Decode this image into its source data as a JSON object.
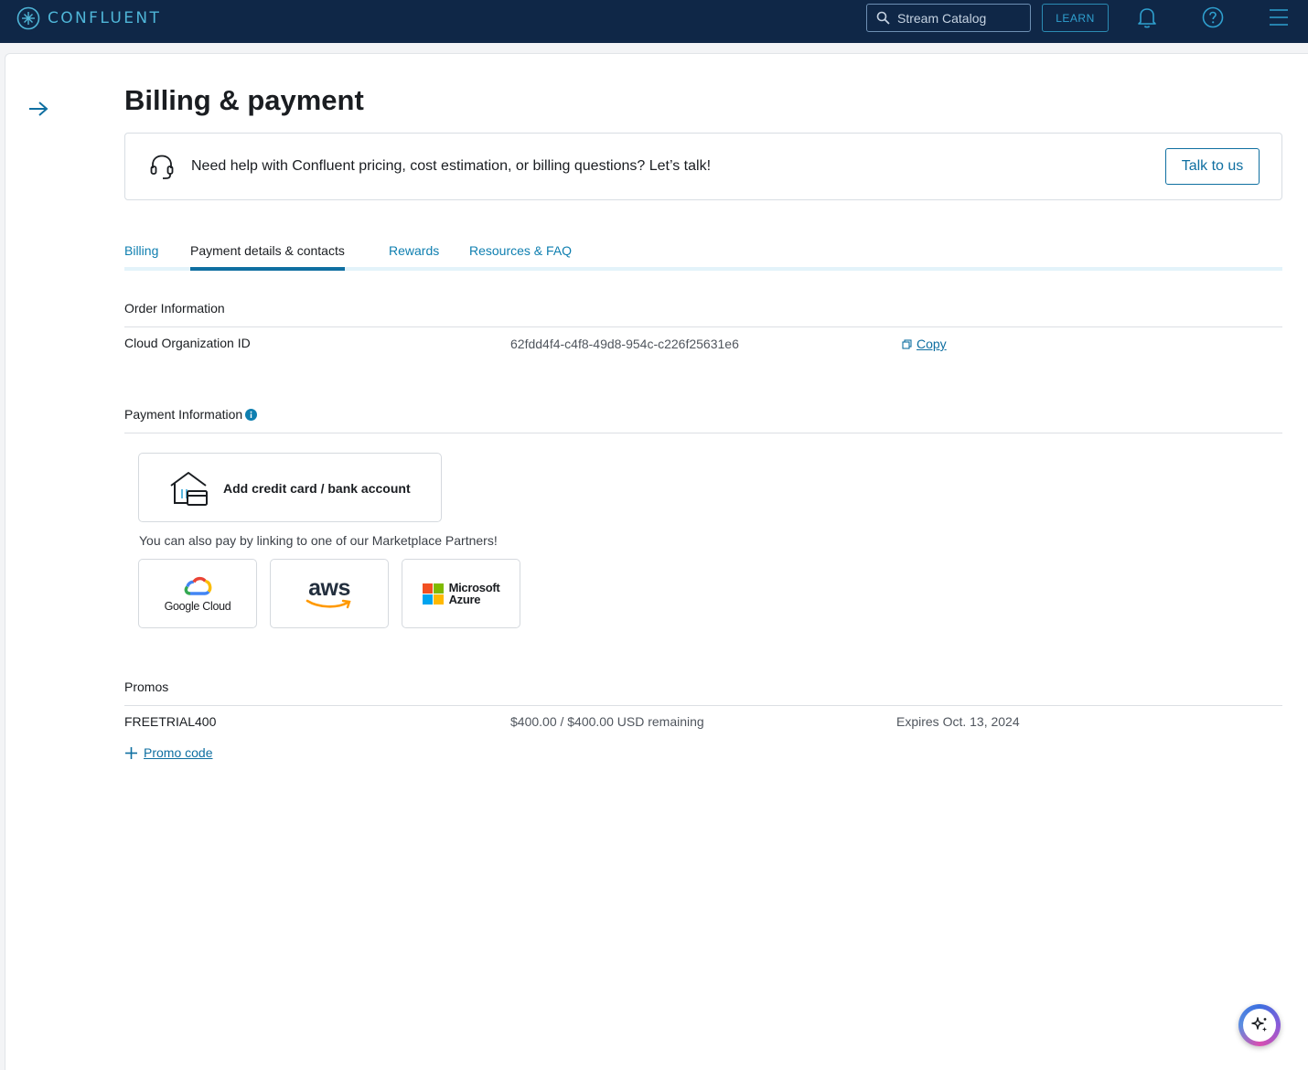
{
  "topbar": {
    "logo_text": "CONFLUENT",
    "search_placeholder": "Stream Catalog",
    "learn_label": "LEARN"
  },
  "page": {
    "title": "Billing & payment"
  },
  "help_banner": {
    "text": "Need help with Confluent pricing, cost estimation, or billing questions? Let’s talk!",
    "button_label": "Talk to us"
  },
  "tabs": [
    {
      "label": "Billing"
    },
    {
      "label": "Payment details & contacts"
    },
    {
      "label": "Rewards"
    },
    {
      "label": "Resources & FAQ"
    }
  ],
  "order_info": {
    "title": "Order Information",
    "org_label": "Cloud Organization ID",
    "org_id": "62fdd4f4-c4f8-49d8-954c-c226f25631e6",
    "copy_label": "Copy"
  },
  "payment_info": {
    "title": "Payment Information",
    "add_card_label": "Add credit card / bank account",
    "partners_text": "You can also pay by linking to one of our Marketplace Partners!",
    "partners": {
      "google": "Google Cloud",
      "aws": "aws",
      "azure_line1": "Microsoft",
      "azure_line2": "Azure"
    }
  },
  "promos": {
    "title": "Promos",
    "code": "FREETRIAL400",
    "remaining": "$400.00 / $400.00 USD remaining",
    "expires": "Expires Oct. 13, 2024",
    "add_label": "Promo code"
  },
  "colors": {
    "topbar_bg": "#0f2747",
    "accent": "#0f6fa1",
    "tab_link": "#0f7fb0"
  }
}
